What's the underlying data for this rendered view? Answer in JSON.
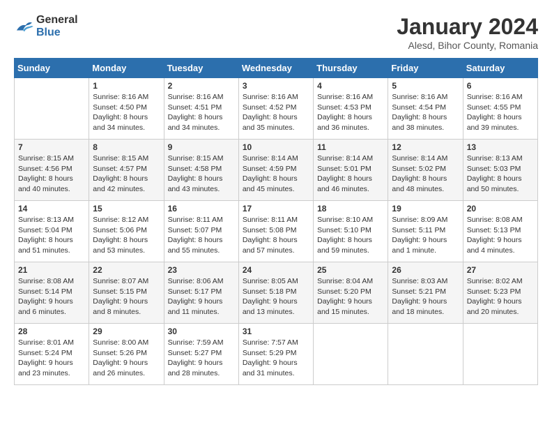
{
  "header": {
    "logo_line1": "General",
    "logo_line2": "Blue",
    "month_title": "January 2024",
    "location": "Alesd, Bihor County, Romania"
  },
  "days_of_week": [
    "Sunday",
    "Monday",
    "Tuesday",
    "Wednesday",
    "Thursday",
    "Friday",
    "Saturday"
  ],
  "weeks": [
    [
      {
        "day": "",
        "sunrise": "",
        "sunset": "",
        "daylight": ""
      },
      {
        "day": "1",
        "sunrise": "Sunrise: 8:16 AM",
        "sunset": "Sunset: 4:50 PM",
        "daylight": "Daylight: 8 hours and 34 minutes."
      },
      {
        "day": "2",
        "sunrise": "Sunrise: 8:16 AM",
        "sunset": "Sunset: 4:51 PM",
        "daylight": "Daylight: 8 hours and 34 minutes."
      },
      {
        "day": "3",
        "sunrise": "Sunrise: 8:16 AM",
        "sunset": "Sunset: 4:52 PM",
        "daylight": "Daylight: 8 hours and 35 minutes."
      },
      {
        "day": "4",
        "sunrise": "Sunrise: 8:16 AM",
        "sunset": "Sunset: 4:53 PM",
        "daylight": "Daylight: 8 hours and 36 minutes."
      },
      {
        "day": "5",
        "sunrise": "Sunrise: 8:16 AM",
        "sunset": "Sunset: 4:54 PM",
        "daylight": "Daylight: 8 hours and 38 minutes."
      },
      {
        "day": "6",
        "sunrise": "Sunrise: 8:16 AM",
        "sunset": "Sunset: 4:55 PM",
        "daylight": "Daylight: 8 hours and 39 minutes."
      }
    ],
    [
      {
        "day": "7",
        "sunrise": "Sunrise: 8:15 AM",
        "sunset": "Sunset: 4:56 PM",
        "daylight": "Daylight: 8 hours and 40 minutes."
      },
      {
        "day": "8",
        "sunrise": "Sunrise: 8:15 AM",
        "sunset": "Sunset: 4:57 PM",
        "daylight": "Daylight: 8 hours and 42 minutes."
      },
      {
        "day": "9",
        "sunrise": "Sunrise: 8:15 AM",
        "sunset": "Sunset: 4:58 PM",
        "daylight": "Daylight: 8 hours and 43 minutes."
      },
      {
        "day": "10",
        "sunrise": "Sunrise: 8:14 AM",
        "sunset": "Sunset: 4:59 PM",
        "daylight": "Daylight: 8 hours and 45 minutes."
      },
      {
        "day": "11",
        "sunrise": "Sunrise: 8:14 AM",
        "sunset": "Sunset: 5:01 PM",
        "daylight": "Daylight: 8 hours and 46 minutes."
      },
      {
        "day": "12",
        "sunrise": "Sunrise: 8:14 AM",
        "sunset": "Sunset: 5:02 PM",
        "daylight": "Daylight: 8 hours and 48 minutes."
      },
      {
        "day": "13",
        "sunrise": "Sunrise: 8:13 AM",
        "sunset": "Sunset: 5:03 PM",
        "daylight": "Daylight: 8 hours and 50 minutes."
      }
    ],
    [
      {
        "day": "14",
        "sunrise": "Sunrise: 8:13 AM",
        "sunset": "Sunset: 5:04 PM",
        "daylight": "Daylight: 8 hours and 51 minutes."
      },
      {
        "day": "15",
        "sunrise": "Sunrise: 8:12 AM",
        "sunset": "Sunset: 5:06 PM",
        "daylight": "Daylight: 8 hours and 53 minutes."
      },
      {
        "day": "16",
        "sunrise": "Sunrise: 8:11 AM",
        "sunset": "Sunset: 5:07 PM",
        "daylight": "Daylight: 8 hours and 55 minutes."
      },
      {
        "day": "17",
        "sunrise": "Sunrise: 8:11 AM",
        "sunset": "Sunset: 5:08 PM",
        "daylight": "Daylight: 8 hours and 57 minutes."
      },
      {
        "day": "18",
        "sunrise": "Sunrise: 8:10 AM",
        "sunset": "Sunset: 5:10 PM",
        "daylight": "Daylight: 8 hours and 59 minutes."
      },
      {
        "day": "19",
        "sunrise": "Sunrise: 8:09 AM",
        "sunset": "Sunset: 5:11 PM",
        "daylight": "Daylight: 9 hours and 1 minute."
      },
      {
        "day": "20",
        "sunrise": "Sunrise: 8:08 AM",
        "sunset": "Sunset: 5:13 PM",
        "daylight": "Daylight: 9 hours and 4 minutes."
      }
    ],
    [
      {
        "day": "21",
        "sunrise": "Sunrise: 8:08 AM",
        "sunset": "Sunset: 5:14 PM",
        "daylight": "Daylight: 9 hours and 6 minutes."
      },
      {
        "day": "22",
        "sunrise": "Sunrise: 8:07 AM",
        "sunset": "Sunset: 5:15 PM",
        "daylight": "Daylight: 9 hours and 8 minutes."
      },
      {
        "day": "23",
        "sunrise": "Sunrise: 8:06 AM",
        "sunset": "Sunset: 5:17 PM",
        "daylight": "Daylight: 9 hours and 11 minutes."
      },
      {
        "day": "24",
        "sunrise": "Sunrise: 8:05 AM",
        "sunset": "Sunset: 5:18 PM",
        "daylight": "Daylight: 9 hours and 13 minutes."
      },
      {
        "day": "25",
        "sunrise": "Sunrise: 8:04 AM",
        "sunset": "Sunset: 5:20 PM",
        "daylight": "Daylight: 9 hours and 15 minutes."
      },
      {
        "day": "26",
        "sunrise": "Sunrise: 8:03 AM",
        "sunset": "Sunset: 5:21 PM",
        "daylight": "Daylight: 9 hours and 18 minutes."
      },
      {
        "day": "27",
        "sunrise": "Sunrise: 8:02 AM",
        "sunset": "Sunset: 5:23 PM",
        "daylight": "Daylight: 9 hours and 20 minutes."
      }
    ],
    [
      {
        "day": "28",
        "sunrise": "Sunrise: 8:01 AM",
        "sunset": "Sunset: 5:24 PM",
        "daylight": "Daylight: 9 hours and 23 minutes."
      },
      {
        "day": "29",
        "sunrise": "Sunrise: 8:00 AM",
        "sunset": "Sunset: 5:26 PM",
        "daylight": "Daylight: 9 hours and 26 minutes."
      },
      {
        "day": "30",
        "sunrise": "Sunrise: 7:59 AM",
        "sunset": "Sunset: 5:27 PM",
        "daylight": "Daylight: 9 hours and 28 minutes."
      },
      {
        "day": "31",
        "sunrise": "Sunrise: 7:57 AM",
        "sunset": "Sunset: 5:29 PM",
        "daylight": "Daylight: 9 hours and 31 minutes."
      },
      {
        "day": "",
        "sunrise": "",
        "sunset": "",
        "daylight": ""
      },
      {
        "day": "",
        "sunrise": "",
        "sunset": "",
        "daylight": ""
      },
      {
        "day": "",
        "sunrise": "",
        "sunset": "",
        "daylight": ""
      }
    ]
  ]
}
